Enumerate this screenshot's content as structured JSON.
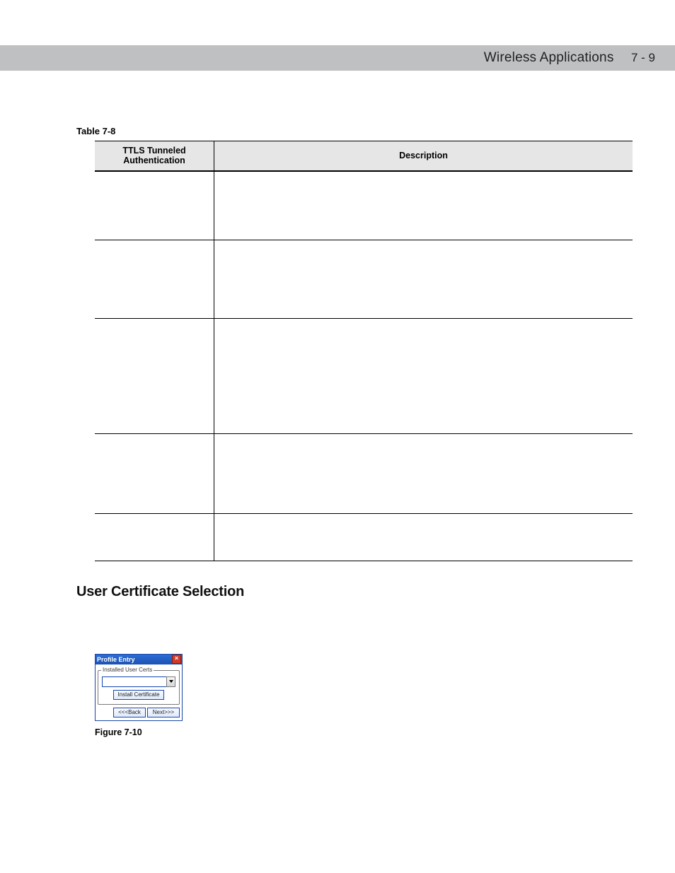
{
  "header": {
    "chapter_title": "Wireless Applications",
    "page_number": "7 - 9"
  },
  "table": {
    "caption": "Table 7-8",
    "col1_header_line1": "TTLS Tunneled",
    "col1_header_line2": "Authentication",
    "col2_header": "Description",
    "rows": [
      {
        "auth": "",
        "desc": ""
      },
      {
        "auth": "",
        "desc": ""
      },
      {
        "auth": "",
        "desc": ""
      },
      {
        "auth": "",
        "desc": ""
      },
      {
        "auth": "",
        "desc": ""
      }
    ]
  },
  "section": {
    "heading": "User Certificate Selection"
  },
  "dialog": {
    "title": "Profile Entry",
    "close_glyph": "×",
    "group_legend": "Installed User Certs",
    "combo_value": "",
    "install_btn": "Install Certificate",
    "back_btn": "<<<Back",
    "next_btn": "Next>>>"
  },
  "figure": {
    "caption": "Figure 7-10"
  }
}
